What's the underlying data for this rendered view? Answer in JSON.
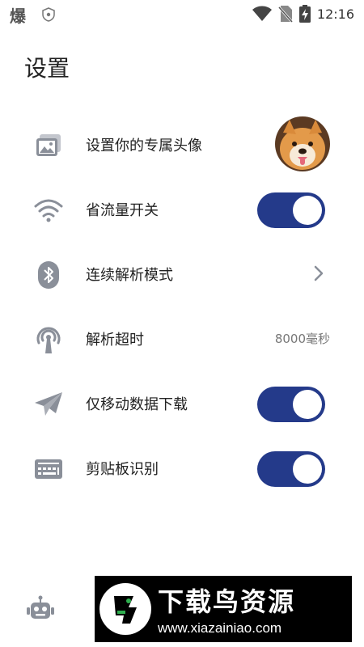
{
  "status_bar": {
    "app_glyph": "爆",
    "time": "12:16"
  },
  "page": {
    "title": "设置"
  },
  "settings": [
    {
      "label": "设置你的专属头像",
      "control": "avatar",
      "icon": "image-icon"
    },
    {
      "label": "省流量开关",
      "control": "toggle",
      "state": "on",
      "icon": "wifi-icon"
    },
    {
      "label": "连续解析模式",
      "control": "chevron",
      "icon": "bluetooth-icon"
    },
    {
      "label": "解析超时",
      "control": "value",
      "value": "8000毫秒",
      "icon": "antenna-icon"
    },
    {
      "label": "仅移动数据下载",
      "control": "toggle",
      "state": "on",
      "icon": "paper-plane-icon"
    },
    {
      "label": "剪贴板识别",
      "control": "toggle",
      "state": "on",
      "icon": "keyboard-icon"
    }
  ],
  "watermark": {
    "brand": "下载鸟资源",
    "url": "www.xiazainiao.com"
  },
  "colors": {
    "toggle_on": "#243a8a",
    "icon": "#8a8f99",
    "text": "#222222",
    "value_text": "#777777"
  }
}
